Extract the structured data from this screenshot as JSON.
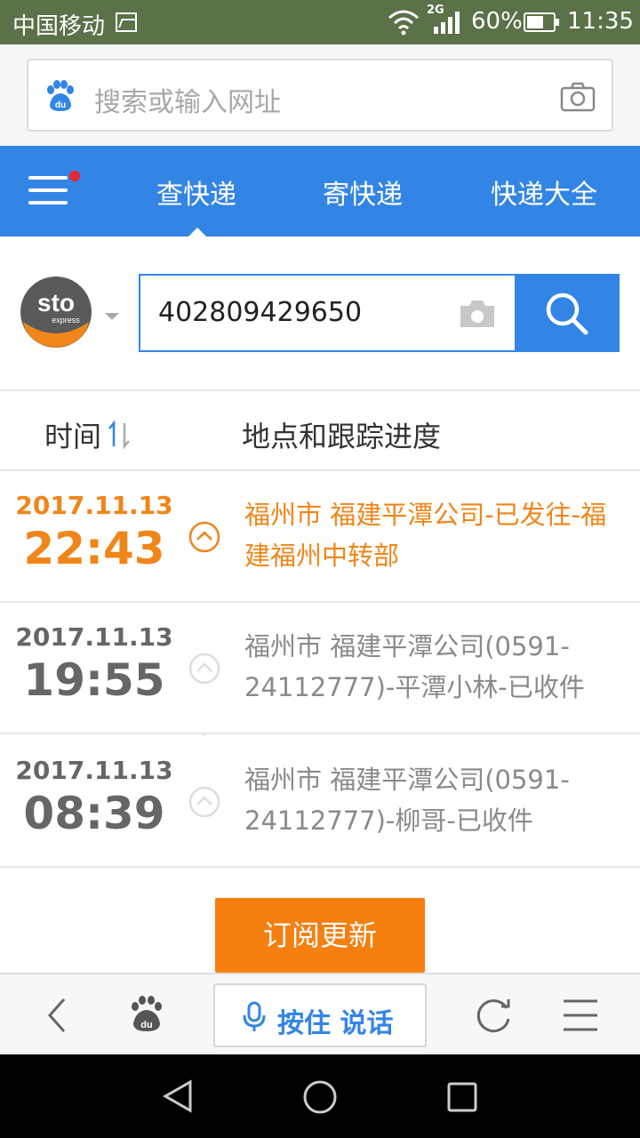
{
  "status_bar": {
    "carrier": "中国移动",
    "network": "2G",
    "battery": "60%",
    "time": "11:35"
  },
  "search": {
    "placeholder": "搜索或输入网址"
  },
  "tabs": [
    {
      "label": "查快递",
      "active": true
    },
    {
      "label": "寄快递",
      "active": false
    },
    {
      "label": "快递大全",
      "active": false
    }
  ],
  "tracker": {
    "carrier_logo_text": "sto",
    "carrier_logo_sub": "express",
    "tracking_number": "402809429650"
  },
  "table": {
    "col_time": "时间",
    "col_location": "地点和跟踪进度",
    "rows": [
      {
        "date": "2017.11.13",
        "time": "22:43",
        "detail": "福州市 福建平潭公司-已发往-福建福州中转部",
        "active": true
      },
      {
        "date": "2017.11.13",
        "time": "19:55",
        "detail": "福州市 福建平潭公司(0591-24112777)-平潭小林-已收件",
        "active": false
      },
      {
        "date": "2017.11.13",
        "time": "08:39",
        "detail": "福州市 福建平潭公司(0591-24112777)-柳哥-已收件",
        "active": false
      }
    ]
  },
  "subscribe_label": "订阅更新",
  "toolbar": {
    "voice_label": "按住 说话"
  },
  "colors": {
    "brand_blue": "#3385e5",
    "accent_orange": "#f08519",
    "status_bar": "#5b7148"
  }
}
